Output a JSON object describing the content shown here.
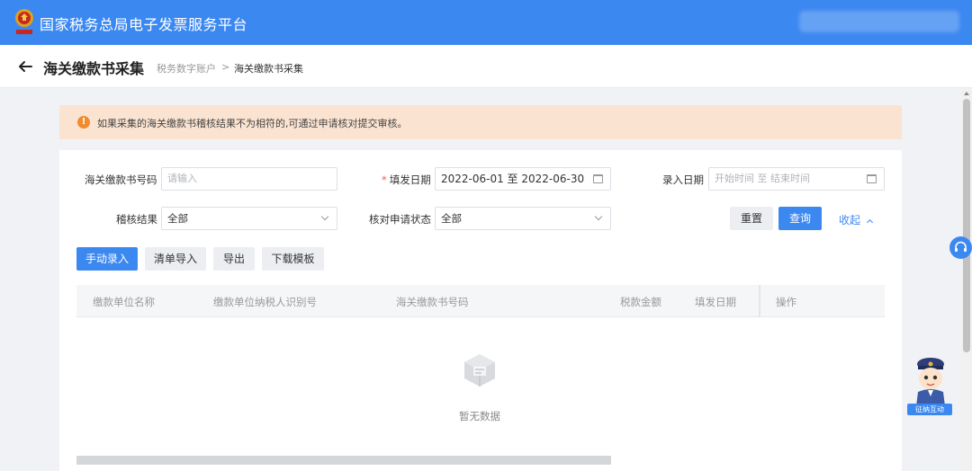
{
  "app": {
    "title": "国家税务总局电子发票服务平台"
  },
  "header": {
    "title": "海关缴款书采集",
    "breadcrumb": [
      "税务数字账户",
      "海关缴款书采集"
    ],
    "breadcrumb_sep": ">"
  },
  "notice": {
    "text": "如果采集的海关缴款书稽核结果不为相符的,可通过申请核对提交审核。"
  },
  "filters": {
    "code_label": "海关缴款书号码",
    "code_placeholder": "请输入",
    "fill_date_label": "填发日期",
    "fill_date_value": "2022-06-01 至 2022-06-30",
    "entry_date_label": "录入日期",
    "entry_date_placeholder": "开始时间 至 结束时间",
    "audit_label": "稽核结果",
    "audit_value": "全部",
    "check_label": "核对申请状态",
    "check_value": "全部"
  },
  "actions": {
    "reset": "重置",
    "query": "查询",
    "collapse": "收起"
  },
  "toolbar": {
    "manual": "手动录入",
    "import": "清单导入",
    "export": "导出",
    "template": "下载模板"
  },
  "table": {
    "columns": [
      "缴款单位名称",
      "缴款单位纳税人识别号",
      "海关缴款书号码",
      "税款金额",
      "填发日期",
      "操作"
    ],
    "empty_text": "暂无数据"
  },
  "widgets": {
    "mascot_label": "征纳互动"
  },
  "colors": {
    "primary": "#3c88f1",
    "notice_bg": "#fbe3d1",
    "warning": "#f08c2f"
  }
}
